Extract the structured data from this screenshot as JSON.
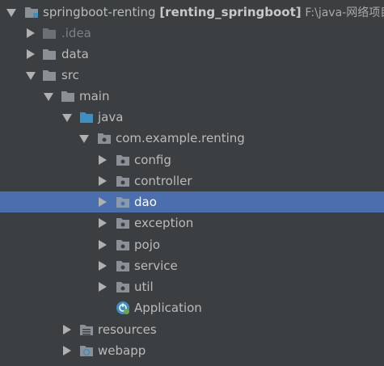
{
  "project": {
    "name": "springboot-renting",
    "module": "[renting_springboot]",
    "path": "F:\\java-网络项目"
  },
  "folders": {
    "idea": ".idea",
    "data": "data",
    "src": "src",
    "main": "main",
    "java": "java",
    "package": "com.example.renting",
    "config": "config",
    "controller": "controller",
    "dao": "dao",
    "exception": "exception",
    "pojo": "pojo",
    "service": "service",
    "util": "util",
    "application": "Application",
    "resources": "resources",
    "webapp": "webapp"
  },
  "colors": {
    "background": "#3c3f41",
    "selection": "#4b6eaf",
    "folder": "#8a9095",
    "source_folder": "#3d8fc4",
    "text": "#bbbbbb"
  },
  "icons": {
    "folder": "folder-icon",
    "source_folder": "source-folder-icon",
    "package": "package-icon",
    "resources_folder": "resources-folder-icon",
    "web_folder": "web-folder-icon",
    "spring_class": "spring-boot-class-icon",
    "module": "module-icon"
  },
  "selected_item": "dao"
}
